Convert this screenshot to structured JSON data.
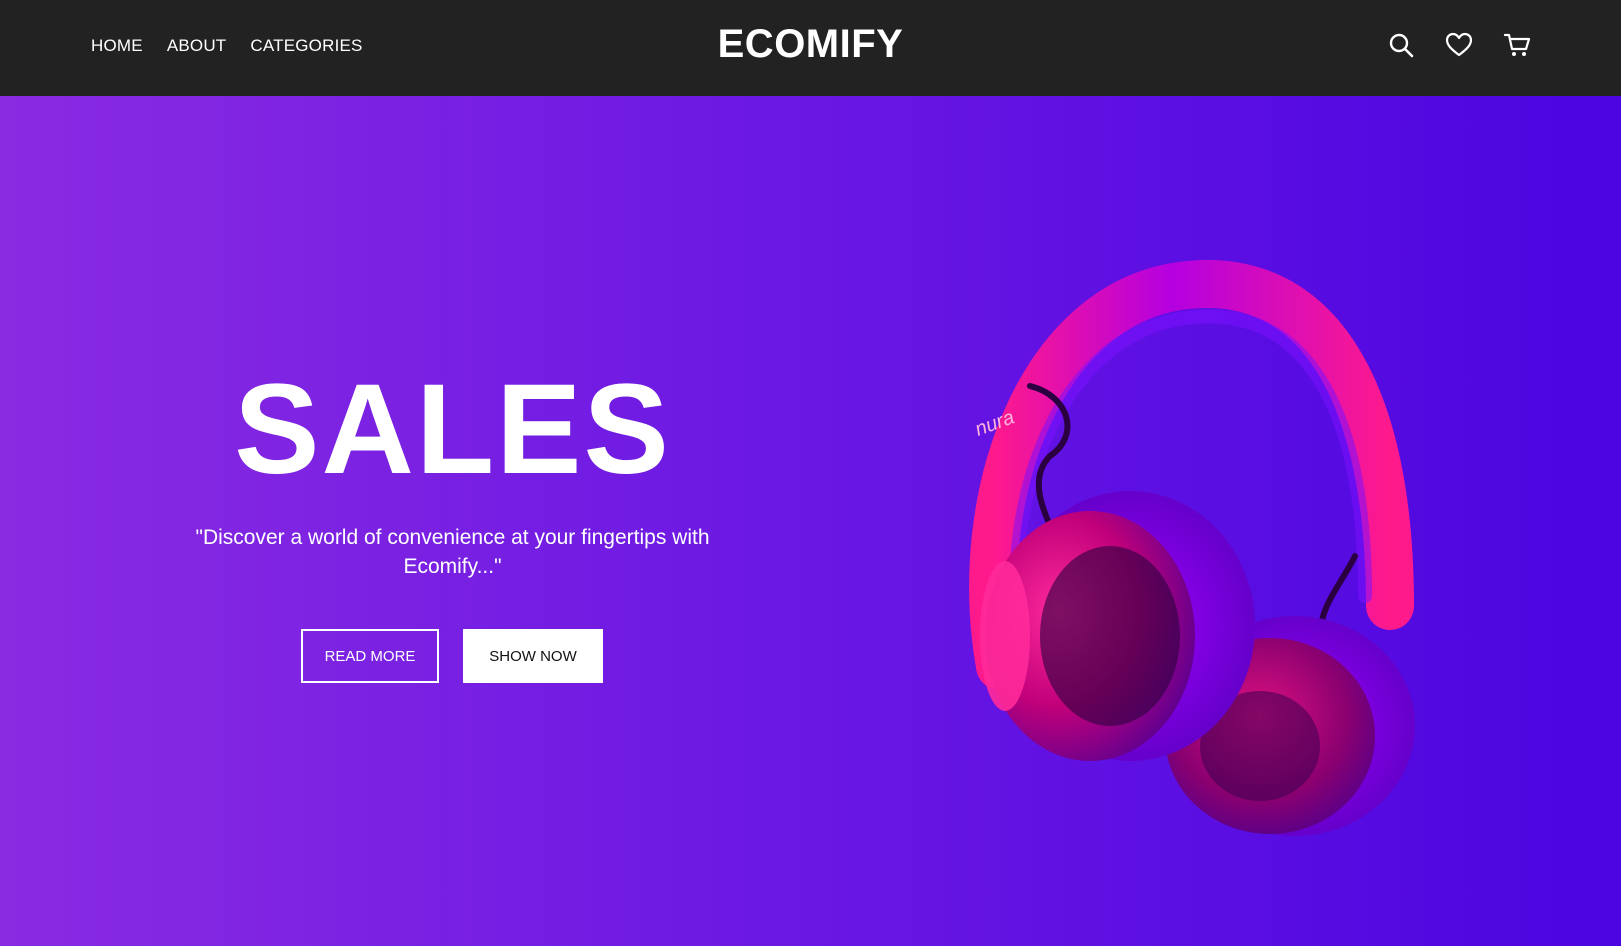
{
  "nav": {
    "links": [
      "HOME",
      "ABOUT",
      "CATEGORIES"
    ],
    "brand": "ECOMIFY",
    "icons": [
      "search-icon",
      "heart-icon",
      "cart-icon"
    ]
  },
  "hero": {
    "title": "SALES",
    "tagline": "\"Discover a world of convenience at your fingertips with Ecomify...\"",
    "buttons": {
      "read_more": "READ MORE",
      "show_now": "SHOW NOW"
    },
    "image": "headphones-image",
    "image_brand_text": "nura"
  },
  "colors": {
    "navbar_bg": "#222222",
    "hero_gradient_start": "#8a2be2",
    "hero_gradient_end": "#4b05e0",
    "headphone_pink": "#ff1a8c",
    "headphone_purple": "#8a00ff"
  }
}
